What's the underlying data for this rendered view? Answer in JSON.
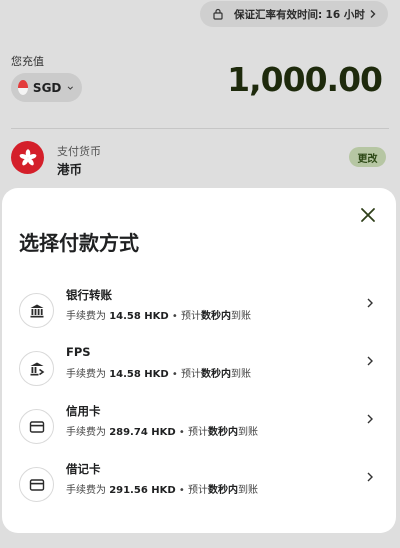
{
  "rate_lock": {
    "text": "保证汇率有效时间:",
    "hours": "16 小时"
  },
  "you_pay": {
    "label": "您充值",
    "currency": "SGD",
    "amount": "1,000.00"
  },
  "receive": {
    "label": "支付货币",
    "currency_name": "港币",
    "change_label": "更改"
  },
  "sheet": {
    "title": "选择付款方式",
    "methods": [
      {
        "name": "银行转账",
        "icon": "bank-icon",
        "fee_prefix": "手续费为",
        "fee": "14.58 HKD",
        "sep": " • ",
        "eta_prefix": "预计",
        "eta_bold": "数秒内",
        "eta_suffix": "到账"
      },
      {
        "name": "FPS",
        "icon": "fps-icon",
        "fee_prefix": "手续费为",
        "fee": "14.58 HKD",
        "sep": " • ",
        "eta_prefix": "预计",
        "eta_bold": "数秒内",
        "eta_suffix": "到账"
      },
      {
        "name": "信用卡",
        "icon": "card-icon",
        "fee_prefix": "手续费为",
        "fee": "289.74 HKD",
        "sep": " • ",
        "eta_prefix": "预计",
        "eta_bold": "数秒内",
        "eta_suffix": "到账"
      },
      {
        "name": "借记卡",
        "icon": "card-icon",
        "fee_prefix": "手续费为",
        "fee": "291.56 HKD",
        "sep": " • ",
        "eta_prefix": "预计",
        "eta_bold": "数秒内",
        "eta_suffix": "到账"
      }
    ]
  },
  "colors": {
    "accent_dark_green": "#1e2a0c",
    "change_bg": "#b6c6a3",
    "hk_red": "#d41f2a",
    "overlay_bg": "#dedede",
    "sheet_bg": "#ffffff"
  }
}
